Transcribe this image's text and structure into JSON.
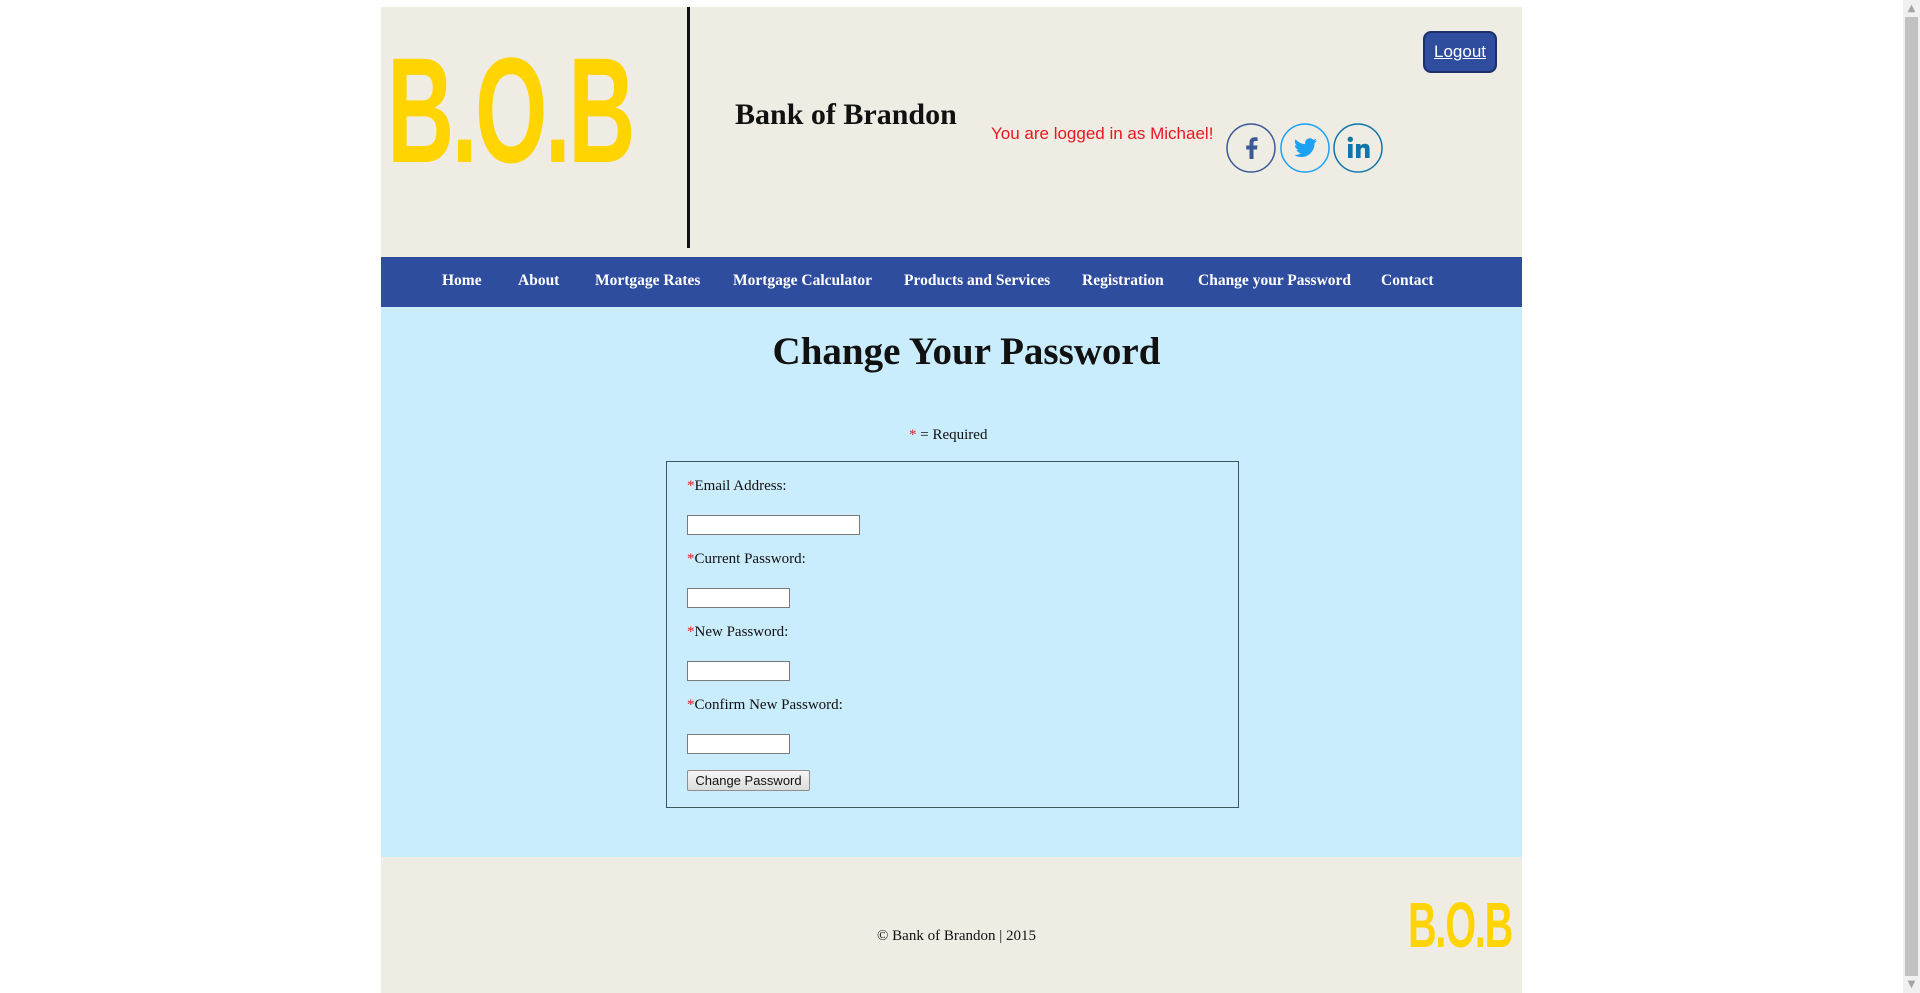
{
  "header": {
    "logo_text": "B.O.B",
    "brand_title": "Bank of Brandon",
    "logged_in_text": "You are logged in as Michael!",
    "logout_label": "Logout",
    "social": [
      "facebook-icon",
      "twitter-icon",
      "linkedin-icon"
    ]
  },
  "nav": {
    "items": [
      {
        "label": "Home"
      },
      {
        "label": "About"
      },
      {
        "label": "Mortgage Rates"
      },
      {
        "label": "Mortgage Calculator"
      },
      {
        "label": "Products and Services"
      },
      {
        "label": "Registration"
      },
      {
        "label": "Change your Password"
      },
      {
        "label": "Contact"
      }
    ]
  },
  "main": {
    "title": "Change Your Password",
    "required_star": "*",
    "required_text": " = Required",
    "fields": [
      {
        "star": "*",
        "label": "Email Address:",
        "value": ""
      },
      {
        "star": "*",
        "label": "Current Password:",
        "value": ""
      },
      {
        "star": "*",
        "label": "New Password:",
        "value": ""
      },
      {
        "star": "*",
        "label": "Confirm New Password:",
        "value": ""
      }
    ],
    "submit_label": "Change Password"
  },
  "footer": {
    "copyright": "© Bank of Brandon | 2015",
    "logo_text": "B.O.B"
  },
  "colors": {
    "header_bg": "#efece3",
    "nav_bg": "#2f4d9f",
    "main_bg": "#c9edfc",
    "logo": "#ffd400",
    "alert": "#e8171f"
  }
}
